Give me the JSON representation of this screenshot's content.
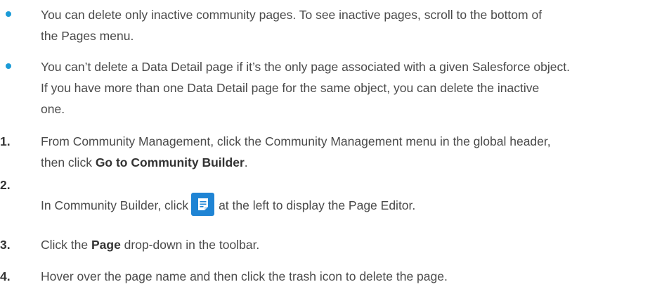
{
  "bullets": [
    {
      "line1": "You can delete only inactive community pages. To see inactive pages, scroll to the bottom of",
      "line2": "the Pages menu."
    },
    {
      "line1": "You can’t delete a Data Detail page if it’s the only page associated with a given Salesforce object.",
      "line2": "If you have more than one Data Detail page for the same object, you can delete the inactive",
      "line3": "one."
    }
  ],
  "steps": [
    {
      "number": "1.",
      "line1": "From Community Management, click the Community Management menu in the global header,",
      "line2_prefix": "then click ",
      "line2_bold": "Go to Community Builder",
      "line2_suffix": "."
    },
    {
      "number": "2.",
      "text_prefix": "In Community Builder, click",
      "icon": "page-editor-icon",
      "text_suffix": "at the left to display the Page Editor."
    },
    {
      "number": "3.",
      "text_prefix": "Click the ",
      "text_bold": "Page",
      "text_suffix": " drop-down in the toolbar."
    },
    {
      "number": "4.",
      "text": "Hover over the page name and then click the trash icon to delete the page."
    }
  ],
  "colors": {
    "bullet": "#1b9bd7",
    "icon_background": "#1f84d4",
    "text": "#4a4a4a"
  }
}
